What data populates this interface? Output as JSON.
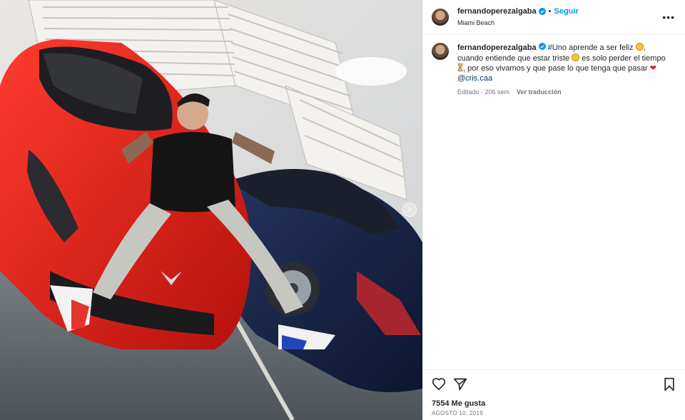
{
  "post": {
    "username": "fernandoperezalgaba",
    "follow_label": "Seguir",
    "separator": "•",
    "location": "Miami Beach",
    "more_label": "•••"
  },
  "caption": {
    "username": "fernandoperezalgaba",
    "hashtag": "#Uno",
    "text_1": " aprende a ser feliz ",
    "text_2": ", cuando entiende que estar triste ",
    "text_3": " es solo perder el tiempo ",
    "text_4": ", por eso vivamos y que pase lo que tenga que pasar ",
    "mention": "@cris.caa",
    "edited": "Editado · 206 sem",
    "translate": "Ver traducción"
  },
  "footer": {
    "likes": "7554 Me gusta",
    "date": "AGOSTO 10, 2019"
  },
  "icons": {
    "verified": "verified-badge-icon",
    "like": "heart-outline-icon",
    "share": "paper-plane-icon",
    "save": "bookmark-icon",
    "next": "chevron-right-icon"
  },
  "colors": {
    "accent": "#0095f6",
    "link": "#00376b",
    "muted": "#737373"
  }
}
